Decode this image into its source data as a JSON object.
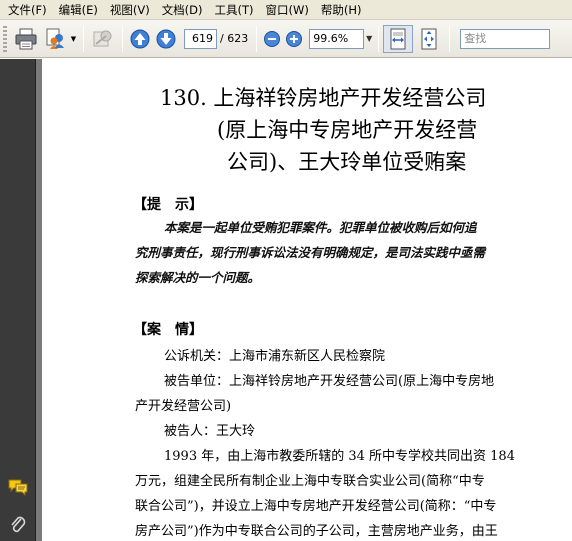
{
  "menu": [
    "文件(F)",
    "编辑(E)",
    "视图(V)",
    "文档(D)",
    "工具(T)",
    "窗口(W)",
    "帮助(H)"
  ],
  "toolbar": {
    "current_page": "619",
    "total_pages": "/ 623",
    "zoom": "99.6%",
    "search_placeholder": "查找"
  },
  "document": {
    "title_lines": [
      "130. 上海祥铃房地产开发经营公司",
      "(原上海中专房地产开发经营",
      "公司)、王大玲单位受贿案"
    ],
    "hint_heading": "【提　示】",
    "hint_lines": [
      "本案是一起单位受贿犯罪案件。犯罪单位被收购后如何追",
      "究刑事责任，现行刑事诉讼法没有明确规定，是司法实践中亟需",
      "探索解决的一个问题。"
    ],
    "case_heading": "【案　情】",
    "case_lines": [
      "公诉机关：上海市浦东新区人民检察院",
      "被告单位：上海祥铃房地产开发经营公司(原上海中专房地",
      "产开发经营公司)",
      "被告人：王大玲",
      "1993 年，由上海市教委所辖的 34 所中专学校共同出资 184",
      "万元，组建全民所有制企业上海中专联合实业公司(简称“中专",
      "联合公司”)，并设立上海中专房地产开发经营公司(简称：“中专",
      "房产公司”)作为中专联合公司的子公司，主营房地产业务，由王"
    ]
  }
}
